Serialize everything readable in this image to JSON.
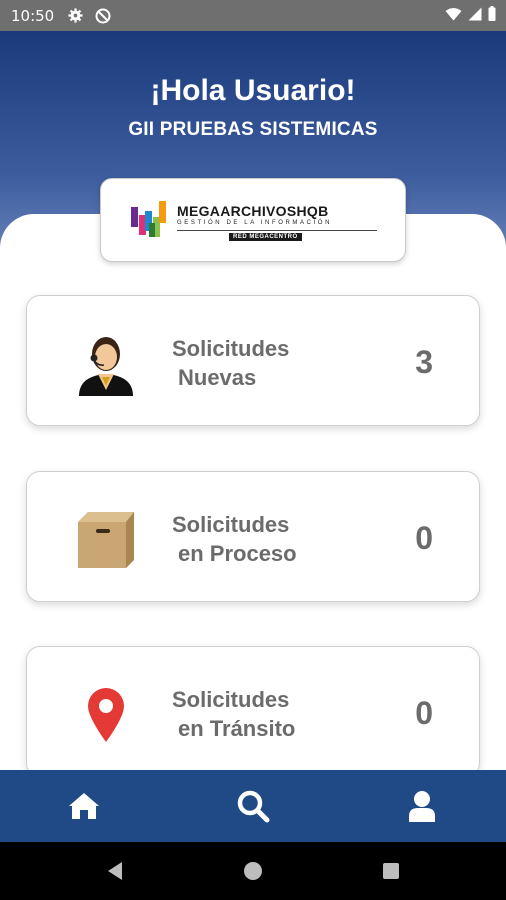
{
  "status_bar": {
    "time": "10:50",
    "left_icons": [
      "gear-icon",
      "at-sign-icon"
    ],
    "right_icons": [
      "wifi-icon",
      "signal-icon",
      "battery-icon"
    ]
  },
  "header": {
    "greeting": "¡Hola Usuario!",
    "company": "GII PRUEBAS SISTEMICAS"
  },
  "logo": {
    "brand": "MEGAARCHIVOSHQB",
    "tagline": "GESTIÓN DE LA INFORMACIÓN",
    "network": "RED MEGACENTRO"
  },
  "cards": [
    {
      "icon": "operator-icon",
      "line1": "Solicitudes",
      "line2": "Nuevas",
      "count": "3"
    },
    {
      "icon": "box-icon",
      "line1": "Solicitudes",
      "line2": "en Proceso",
      "count": "0"
    },
    {
      "icon": "location-pin-icon",
      "line1": "Solicitudes",
      "line2": "en Tránsito",
      "count": "0"
    }
  ],
  "bottom_nav": {
    "items": [
      "home-icon",
      "search-icon",
      "user-icon"
    ]
  },
  "colors": {
    "header_top": "#1a3a7c",
    "header_bottom": "#7b93c6",
    "bottom_nav": "#1f4a85",
    "card_text": "#6b6b6b",
    "pin": "#e53935"
  }
}
